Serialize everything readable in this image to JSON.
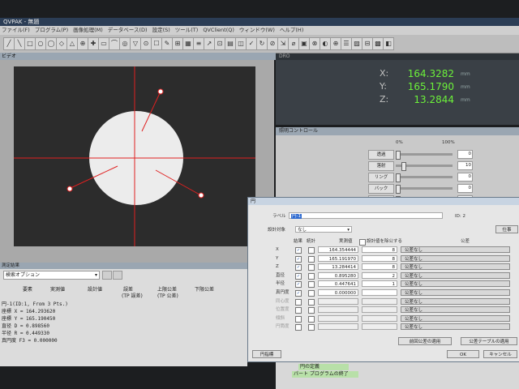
{
  "window": {
    "title": "QVPAK - 無題"
  },
  "menu": [
    "ファイル(F)",
    "プログラム(P)",
    "画像処理(M)",
    "データベース(D)",
    "設定(S)",
    "ツール(T)",
    "QVClient(Q)",
    "ウィンドウ(W)",
    "ヘルプ(H)"
  ],
  "video": {
    "title": "ビデオ"
  },
  "dro": {
    "title": "DRO",
    "x_label": "X:",
    "x_value": "164.3282",
    "x_unit": "mm",
    "y_label": "Y:",
    "y_value": "165.1790",
    "y_unit": "mm",
    "z_label": "Z:",
    "z_value": "13.2844",
    "z_unit": "mm"
  },
  "lighting": {
    "title": "照明コントロール",
    "scale_min": "0%",
    "scale_max": "100%",
    "rows": [
      {
        "label": "透過",
        "value": "0",
        "level": 0.0
      },
      {
        "label": "落射",
        "value": "10",
        "level": 0.1
      },
      {
        "label": "リング",
        "value": "0",
        "level": 0.0
      },
      {
        "label": "バック",
        "value": "0",
        "level": 0.0
      },
      {
        "label": "",
        "value": "1",
        "level": 0.0
      }
    ]
  },
  "results": {
    "title": "測定結果",
    "dropdown": "検索オプション",
    "headers": [
      "要素",
      "実測値",
      "設計値",
      "誤差",
      "上限公差",
      "下限公差"
    ],
    "subheaders": [
      "(TP 誤差)",
      "(TP 公差)"
    ],
    "rows": [
      "円-1(ID:1, From 3 Pts.)",
      "座標 X =    164.293620",
      "座標 Y =    165.190450",
      "直径 D =      0.898560",
      "半径 R =      0.449330",
      "真円度 F3 =                        0.000000"
    ]
  },
  "dialog": {
    "title": "円",
    "label_caption": "ラベル",
    "label_value": "円-1",
    "id_text": "ID: 2",
    "design_caption": "設計対象",
    "design_value": "なし",
    "result_col": "結果",
    "stats_col": "統計",
    "measured_col": "実測値",
    "tol_col": "公差",
    "design_check_label": "設計値を除公する",
    "rows": [
      {
        "label": "X",
        "value": "164.354444",
        "n": "8"
      },
      {
        "label": "Y",
        "value": "165.191970",
        "n": "8"
      },
      {
        "label": "Z",
        "value": "13.284414",
        "n": "8"
      },
      {
        "label": "直径",
        "value": "0.895280",
        "n": "2"
      },
      {
        "label": "半径",
        "value": "0.447641",
        "n": "1"
      },
      {
        "label": "真円度",
        "value": "0.000000",
        "n": ""
      },
      {
        "label": "同心度",
        "value": "",
        "n": ""
      },
      {
        "label": "位置度",
        "value": "",
        "n": ""
      },
      {
        "label": "傾斜",
        "value": "",
        "n": ""
      },
      {
        "label": "円筒度",
        "value": "",
        "n": ""
      }
    ],
    "tol_buttons": [
      "公差なし",
      "公差なし",
      "公差なし",
      "公差なし",
      "公差なし",
      "公差なし",
      "公差なし",
      "公差なし",
      "公差なし",
      "公差なし"
    ],
    "button_prev": "前回公差の適用",
    "button_table": "公差テーブルの適用",
    "button_circle": "円指標",
    "button_ok": "OK",
    "button_cancel": "キャンセル",
    "right_btn": "仕事"
  },
  "tree": {
    "items": [
      "円の定義",
      "パート プログラムの終了"
    ]
  }
}
